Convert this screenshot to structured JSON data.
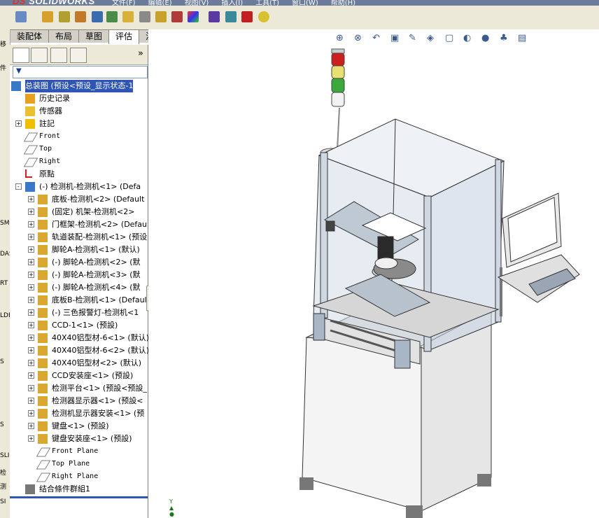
{
  "app": {
    "logo_prefix": "DS",
    "logo_name": "SOLIDWORKS",
    "menus": [
      "文件(F)",
      "编辑(E)",
      "视图(V)",
      "插入(I)",
      "工具(T)",
      "窗口(W)",
      "帮助(H)"
    ]
  },
  "command_tabs": [
    {
      "label": "装配体",
      "active": false
    },
    {
      "label": "布局",
      "active": false
    },
    {
      "label": "草图",
      "active": false
    },
    {
      "label": "评估",
      "active": true
    },
    {
      "label": "渲染工具",
      "active": false
    }
  ],
  "left_clip_texts": [
    "移",
    "件",
    "SM",
    "DAS",
    "RT",
    "LDE",
    "S",
    "S",
    "SLI",
    "检",
    "测",
    "SI"
  ],
  "feature_tree": {
    "filter_icon": "funnel-icon",
    "expand_chevron": "»",
    "root": "总装图 (预设<预设_显示状态-1",
    "items": [
      {
        "label": "历史记录",
        "icon": "history-icon",
        "level": 1,
        "expand": ""
      },
      {
        "label": "传感器",
        "icon": "sensor-icon",
        "level": 1,
        "expand": ""
      },
      {
        "label": "註記",
        "icon": "annotation-icon",
        "level": 1,
        "expand": "+"
      },
      {
        "label": "Front",
        "icon": "plane-icon",
        "level": 1,
        "expand": "",
        "mono": true
      },
      {
        "label": "Top",
        "icon": "plane-icon",
        "level": 1,
        "expand": "",
        "mono": true
      },
      {
        "label": "Right",
        "icon": "plane-icon",
        "level": 1,
        "expand": "",
        "mono": true
      },
      {
        "label": "原點",
        "icon": "origin-icon",
        "level": 1,
        "expand": ""
      },
      {
        "label": "(-) 检测机-检测机<1> (Defa",
        "icon": "subassembly-icon",
        "level": 1,
        "expand": "-"
      },
      {
        "label": "底板-检测机<2> (Default",
        "icon": "part-icon",
        "level": 2,
        "expand": "+"
      },
      {
        "label": "(固定) 机架-检测机<2>",
        "icon": "part-icon",
        "level": 2,
        "expand": "+"
      },
      {
        "label": "门框架-检测机<2> (Defau",
        "icon": "part-icon",
        "level": 2,
        "expand": "+"
      },
      {
        "label": "轨道装配-检测机<1> (预设",
        "icon": "part-icon",
        "level": 2,
        "expand": "+"
      },
      {
        "label": "脚轮A-检测机<1> (默认)",
        "icon": "part-icon",
        "level": 2,
        "expand": "+"
      },
      {
        "label": "(-) 脚轮A-检测机<2> (默",
        "icon": "part-icon",
        "level": 2,
        "expand": "+"
      },
      {
        "label": "(-) 脚轮A-检测机<3> (默",
        "icon": "part-icon",
        "level": 2,
        "expand": "+"
      },
      {
        "label": "(-) 脚轮A-检测机<4> (默",
        "icon": "part-icon",
        "level": 2,
        "expand": "+"
      },
      {
        "label": "底板B-检测机<1> (Defaul",
        "icon": "part-icon",
        "level": 2,
        "expand": "+"
      },
      {
        "label": "(-) 三色报警灯-检测机<1",
        "icon": "part-icon",
        "level": 2,
        "expand": "+"
      },
      {
        "label": "CCD-1<1> (预設)",
        "icon": "part-icon",
        "level": 2,
        "expand": "+"
      },
      {
        "label": "40X40铝型材-6<1> (默认)",
        "icon": "part-icon",
        "level": 2,
        "expand": "+"
      },
      {
        "label": "40X40铝型材-6<2> (默认)",
        "icon": "part-icon",
        "level": 2,
        "expand": "+"
      },
      {
        "label": "40X40铝型材<2> (默认)",
        "icon": "part-icon",
        "level": 2,
        "expand": "+"
      },
      {
        "label": "CCD安装座<1> (预設)",
        "icon": "part-icon",
        "level": 2,
        "expand": "+"
      },
      {
        "label": "检测平台<1> (预設<预設_",
        "icon": "part-icon",
        "level": 2,
        "expand": "+"
      },
      {
        "label": "检测器显示器<1> (预設<",
        "icon": "part-icon",
        "level": 2,
        "expand": "+"
      },
      {
        "label": "检测机显示器安装<1> (预",
        "icon": "part-icon",
        "level": 2,
        "expand": "+"
      },
      {
        "label": "键盘<1> (预設)",
        "icon": "part-icon",
        "level": 2,
        "expand": "+"
      },
      {
        "label": "键盘安装座<1> (预設)",
        "icon": "part-icon",
        "level": 2,
        "expand": "+"
      },
      {
        "label": "Front Plane",
        "icon": "plane-icon",
        "level": 2,
        "expand": "",
        "mono": true
      },
      {
        "label": "Top Plane",
        "icon": "plane-icon",
        "level": 2,
        "expand": "",
        "mono": true
      },
      {
        "label": "Right Plane",
        "icon": "plane-icon",
        "level": 2,
        "expand": "",
        "mono": true
      },
      {
        "label": "结合條件群組1",
        "icon": "mates-icon",
        "level": 1,
        "expand": ""
      }
    ]
  },
  "viewport": {
    "heads_up_icons": [
      "zoom-to-fit-icon",
      "zoom-area-icon",
      "previous-view-icon",
      "section-view-icon",
      "dynamic-annotation-icon",
      "view-orientation-icon",
      "display-style-icon",
      "hide-show-icon",
      "edit-appearance-icon",
      "apply-scene-icon",
      "view-settings-icon"
    ],
    "triad_label": "Y"
  },
  "colors": {
    "selection": "#2f55b5",
    "panel_bg": "#ece9d8",
    "menubar": "#6b7b99"
  }
}
